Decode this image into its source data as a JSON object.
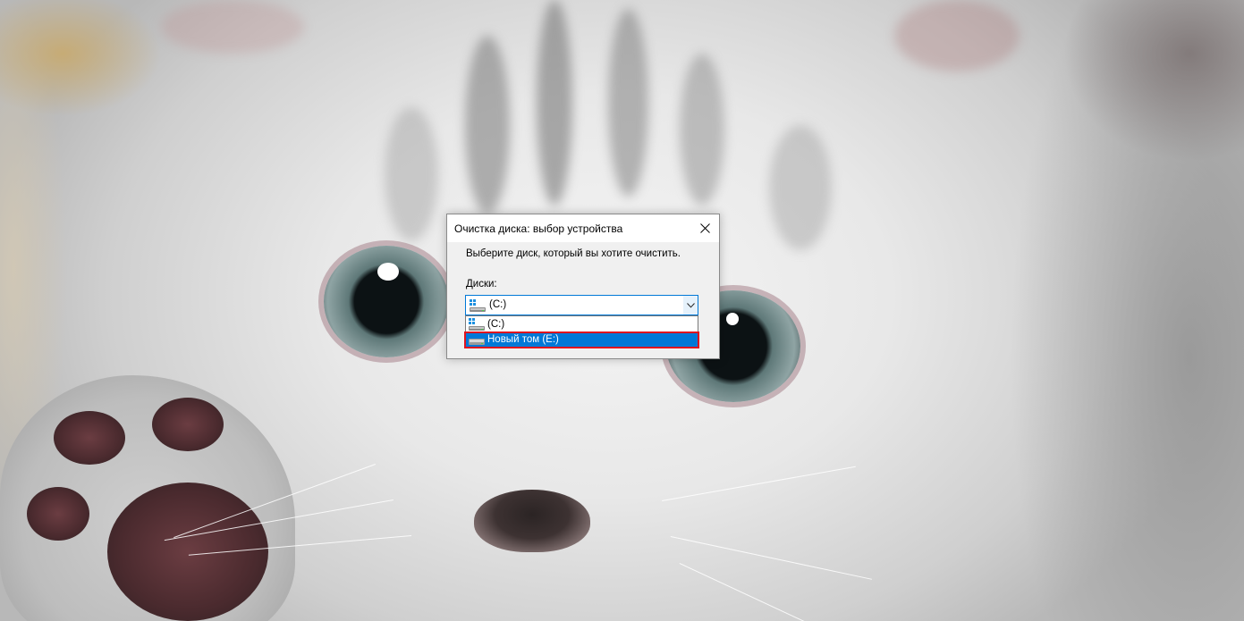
{
  "dialog": {
    "title": "Очистка диска: выбор устройства",
    "prompt": "Выберите диск, который вы хотите очистить.",
    "drives_label": "Диски:",
    "combo": {
      "selected_value": "(C:)",
      "icon": "windows-drive-icon",
      "arrow_icon": "chevron-down-icon"
    },
    "dropdown_options": [
      {
        "label": "(C:)",
        "icon": "windows-drive-icon",
        "selected": false
      },
      {
        "label": "Новый том (E:)",
        "icon": "hard-drive-icon",
        "selected": true
      }
    ],
    "close_icon": "close-icon",
    "accent_color": "#0078d7",
    "highlight_color": "#e0141e"
  }
}
